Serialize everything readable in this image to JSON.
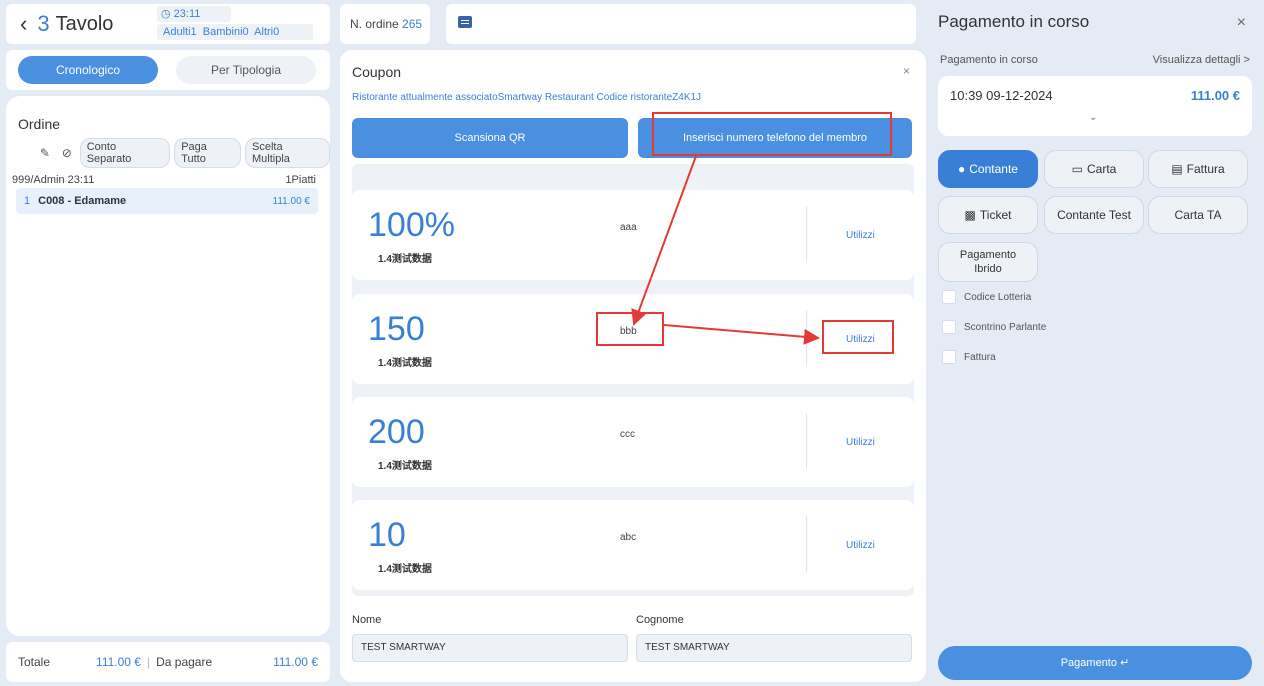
{
  "header": {
    "back_icon": "chevron-left-icon",
    "table_number": "3",
    "table_word": "Tavolo",
    "time": "23:11",
    "adults_label": "Adulti",
    "adults": "1",
    "children_label": "Bambini",
    "children": "0",
    "others_label": "Altri",
    "others": "0"
  },
  "tabs": {
    "chronological": "Cronologico",
    "by_type": "Per Tipologia"
  },
  "order": {
    "title": "Ordine",
    "split_bill": "Conto Separato",
    "pay_all": "Paga Tutto",
    "multiple_choice": "Scelta Multipla",
    "meta_left": "999/Admin 23:11",
    "meta_right": "1Piatti",
    "items": [
      {
        "qty": "1",
        "name": "C008 - Edamame",
        "price": "111.00 €"
      }
    ]
  },
  "totals": {
    "total_label": "Totale",
    "total_value": "111.00 €",
    "due_label": "Da pagare",
    "due_value": "111.00 €"
  },
  "order_number": {
    "label": "N. ordine",
    "value": "265"
  },
  "coupon": {
    "title": "Coupon",
    "close": "×",
    "info": "Ristorante attualmente associatoSmartway Restaurant Codice ristoranteZ4K1J",
    "scan_qr": "Scansiona QR",
    "enter_phone": "Inserisci numero telefono del membro",
    "cards": [
      {
        "value": "100%",
        "sub": "1.4测试数据",
        "name": "aaa",
        "use": "Utilizzi"
      },
      {
        "value": "150",
        "sub": "1.4测试数据",
        "name": "bbb",
        "use": "Utilizzi"
      },
      {
        "value": "200",
        "sub": "1.4测试数据",
        "name": "ccc",
        "use": "Utilizzi"
      },
      {
        "value": "10",
        "sub": "1.4测试数据",
        "name": "abc",
        "use": "Utilizzi"
      }
    ],
    "first_name_label": "Nome",
    "first_name_value": "TEST SMARTWAY",
    "last_name_label": "Cognome",
    "last_name_value": "TEST SMARTWAY"
  },
  "payment": {
    "title": "Pagamento in corso",
    "close": "×",
    "sub_label": "Pagamento in corso",
    "details_link": "Visualizza dettagli >",
    "datetime": "10:39 09-12-2024",
    "amount": "111.00 €",
    "chevron": "⌄",
    "methods": {
      "cash": "Contante",
      "card": "Carta",
      "invoice": "Fattura",
      "ticket": "Ticket",
      "cash_test": "Contante Test",
      "card_ta": "Carta TA",
      "hybrid_1": "Pagamento",
      "hybrid_2": "Ibrido"
    },
    "options": {
      "lottery": "Codice Lotteria",
      "talking_receipt": "Scontrino Parlante",
      "invoice": "Fattura"
    },
    "pay_button": "Pagamento ↵"
  },
  "colors": {
    "accent": "#3a7fd6",
    "button_blue": "#4a8fe0",
    "annotation_red": "#e53935",
    "background": "#e4ebf4"
  }
}
